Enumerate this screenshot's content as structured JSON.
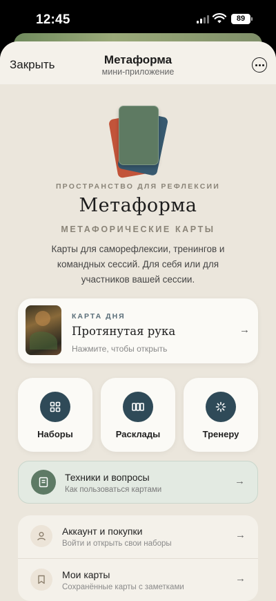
{
  "status_bar": {
    "time": "12:45",
    "battery": "89",
    "icons": [
      "cellular-signal-icon",
      "wifi-icon",
      "battery-icon"
    ]
  },
  "nav": {
    "close_label": "Закрыть",
    "title": "Метаформа",
    "subtitle": "мини-приложение",
    "more_icon": "more-dots-icon"
  },
  "hero": {
    "eyebrow": "ПРОСТРАНСТВО ДЛЯ РЕФЛЕКСИИ",
    "title": "Метаформа",
    "tagline": "МЕТАФОРИЧЕСКИЕ КАРТЫ",
    "description": "Карты для саморефлексии, тренингов и командных сессий. Для себя или для участников вашей сессии."
  },
  "daily_card": {
    "eyebrow": "КАРТА ДНЯ",
    "title": "Протянутая рука",
    "hint": "Нажмите, чтобы открыть",
    "arrow": "→"
  },
  "tiles": [
    {
      "label": "Наборы",
      "icon": "grid-icon"
    },
    {
      "label": "Расклады",
      "icon": "cards-spread-icon"
    },
    {
      "label": "Тренеру",
      "icon": "loader-icon"
    }
  ],
  "techniques": {
    "title": "Техники и вопросы",
    "subtitle": "Как пользоваться картами",
    "icon": "book-icon",
    "arrow": "→"
  },
  "list": [
    {
      "title": "Аккаунт и покупки",
      "subtitle": "Войти и открыть свои наборы",
      "icon": "user-icon",
      "arrow": "→"
    },
    {
      "title": "Мои карты",
      "subtitle": "Сохранённые карты с заметками",
      "icon": "bookmark-icon",
      "arrow": "→"
    }
  ],
  "colors": {
    "sheet_bg": "#ebe6dc",
    "accent_dark": "#2f4a58",
    "accent_green": "#5e7a65",
    "card_red": "#c2543a"
  }
}
